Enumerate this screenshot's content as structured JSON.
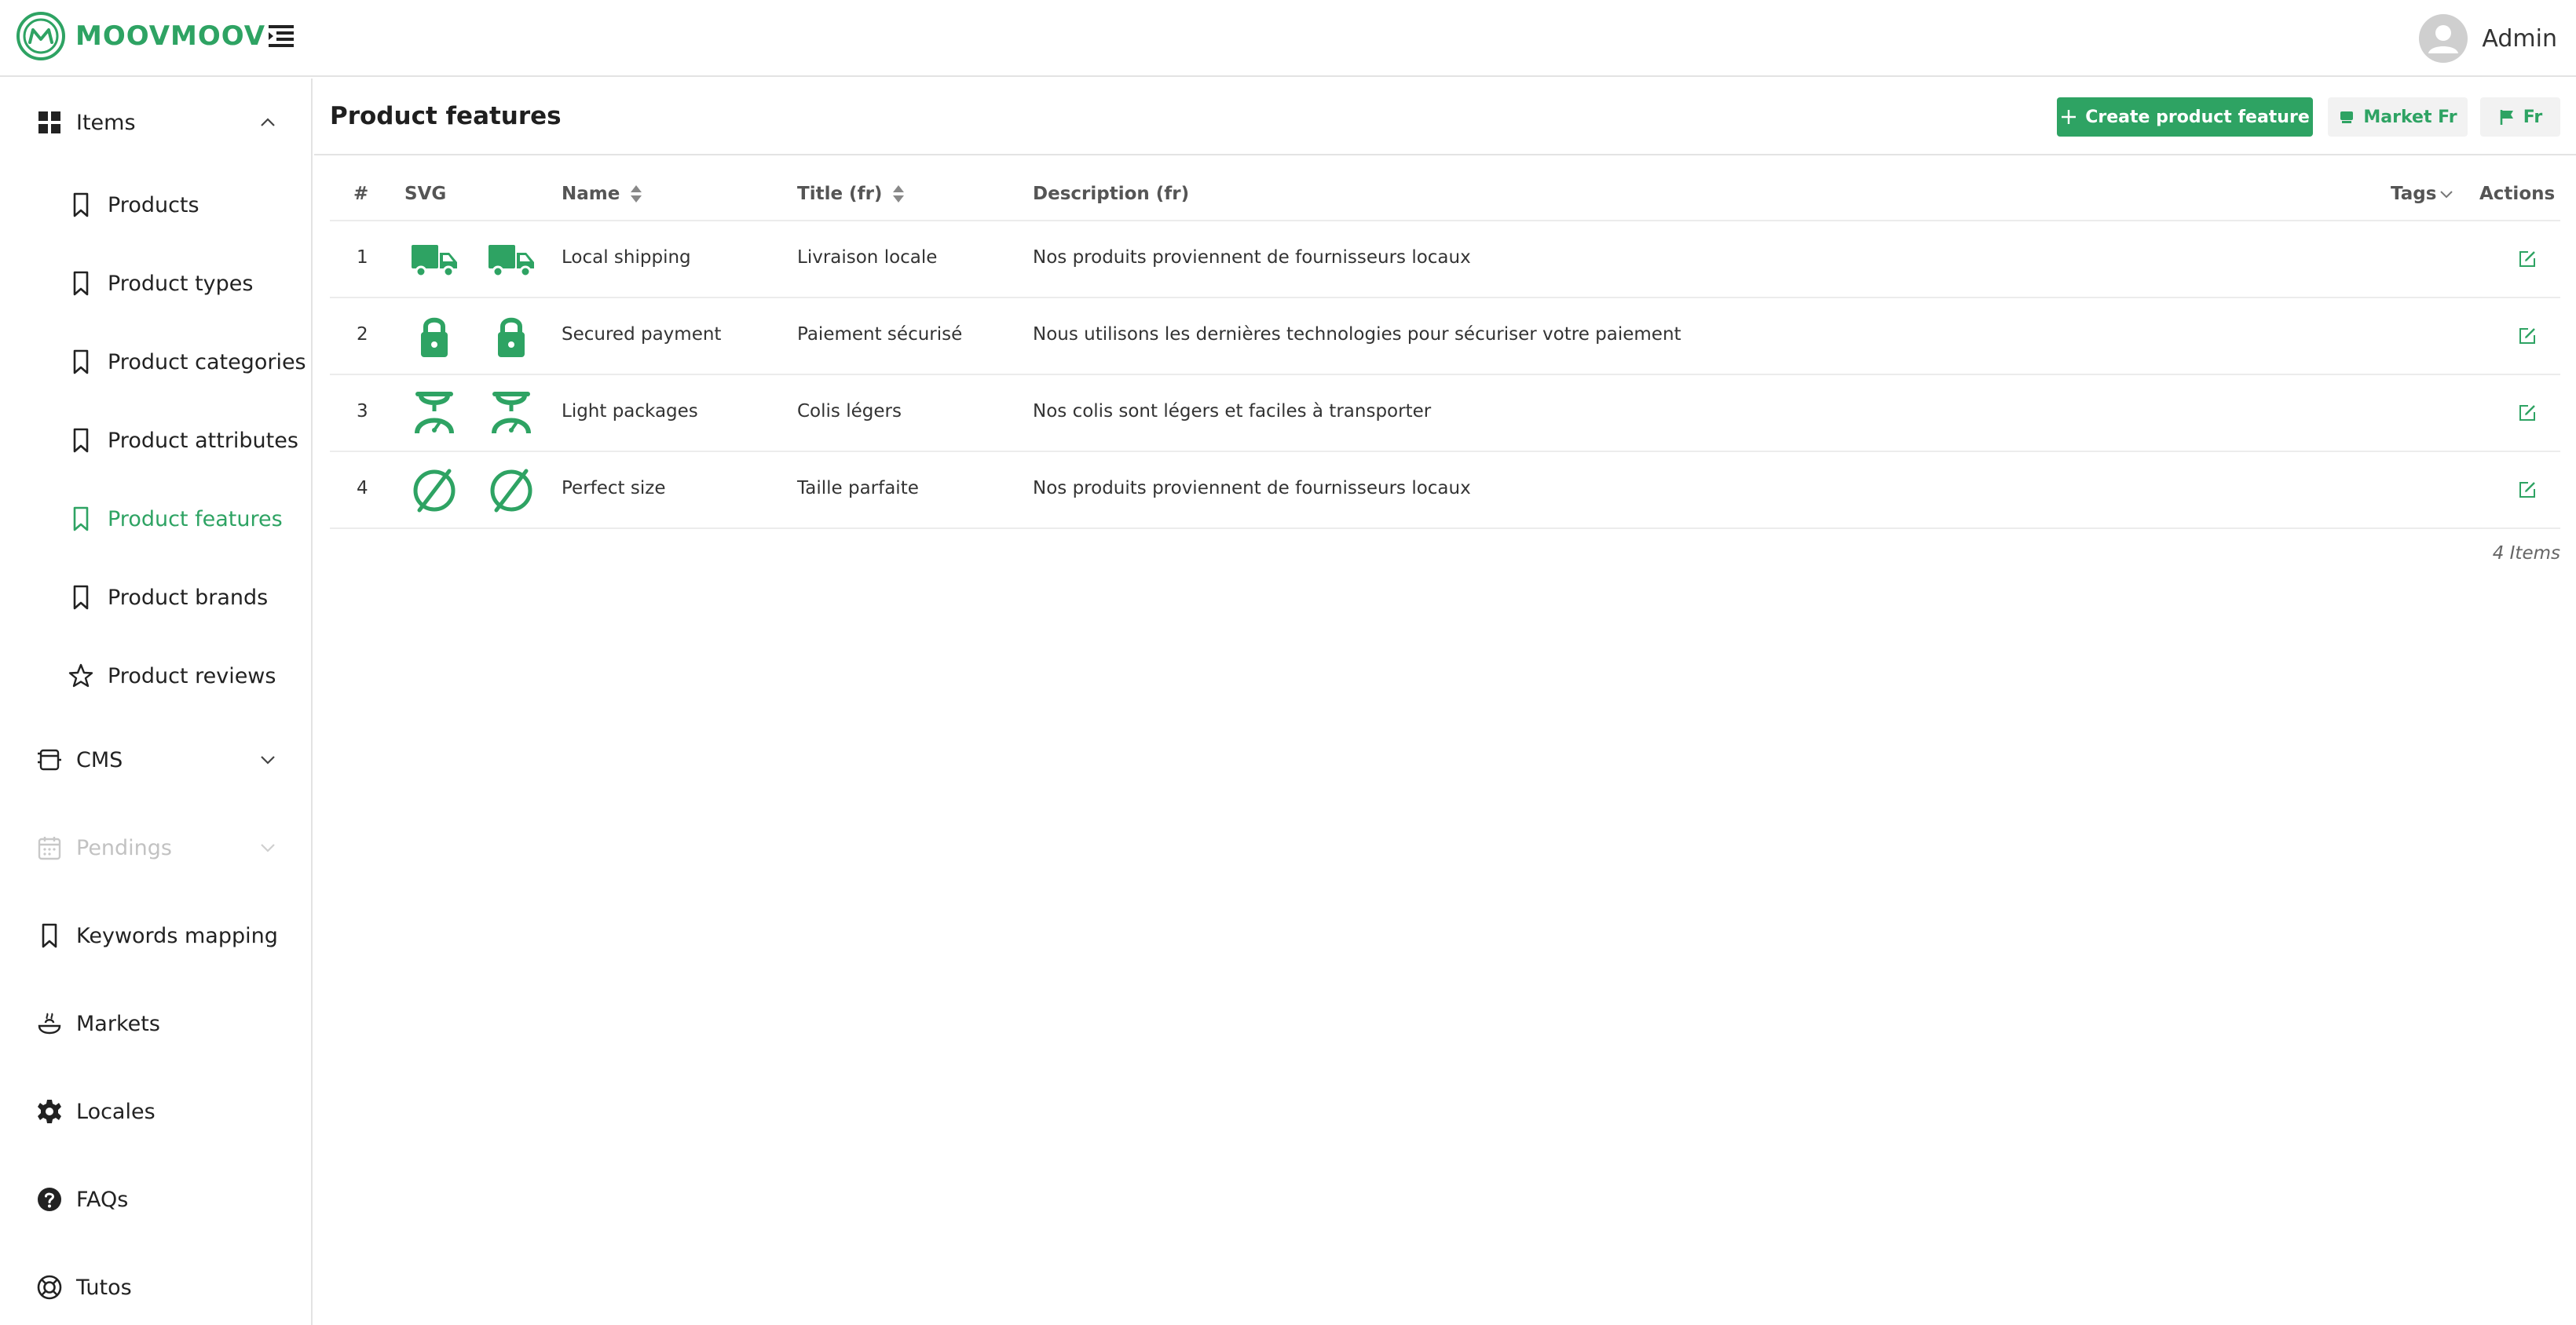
{
  "brand": {
    "name": "MOOVMOOV",
    "accent": "#2ea363"
  },
  "header": {
    "user_name": "Admin",
    "menu_icon": "menu-collapse-icon",
    "avatar_icon": "user-avatar-icon"
  },
  "sidebar": {
    "items": [
      {
        "label": "Items",
        "icon": "grid-icon",
        "expanded": true
      },
      {
        "label": "Products",
        "icon": "bookmark-icon"
      },
      {
        "label": "Product types",
        "icon": "bookmark-icon"
      },
      {
        "label": "Product categories",
        "icon": "bookmark-icon"
      },
      {
        "label": "Product attributes",
        "icon": "bookmark-icon"
      },
      {
        "label": "Product features",
        "icon": "bookmark-icon",
        "active": true
      },
      {
        "label": "Product brands",
        "icon": "bookmark-icon"
      },
      {
        "label": "Product reviews",
        "icon": "star-icon"
      },
      {
        "label": "CMS",
        "icon": "cms-icon",
        "expanded": false
      },
      {
        "label": "Pendings",
        "icon": "calendar-icon",
        "disabled": true
      },
      {
        "label": "Keywords mapping",
        "icon": "bookmark-icon"
      },
      {
        "label": "Markets",
        "icon": "market-icon"
      },
      {
        "label": "Locales",
        "icon": "gear-icon"
      },
      {
        "label": "FAQs",
        "icon": "question-icon"
      },
      {
        "label": "Tutos",
        "icon": "lifebuoy-icon"
      }
    ]
  },
  "main": {
    "title": "Product features",
    "buttons": {
      "create": "Create product feature",
      "market": "Market Fr",
      "locale": "Fr"
    },
    "table": {
      "columns": {
        "index": "#",
        "svg": "SVG",
        "name": "Name",
        "title": "Title (fr)",
        "description": "Description (fr)",
        "tags": "Tags",
        "actions": "Actions"
      },
      "rows": [
        {
          "index": "1",
          "icon": "truck-icon",
          "name": "Local shipping",
          "title": "Livraison locale",
          "description": "Nos produits proviennent de fournisseurs locaux"
        },
        {
          "index": "2",
          "icon": "lock-icon",
          "name": "Secured payment",
          "title": "Paiement sécurisé",
          "description": "Nous utilisons les dernières technologies pour sécuriser votre paiement"
        },
        {
          "index": "3",
          "icon": "scale-icon",
          "name": "Light packages",
          "title": "Colis légers",
          "description": "Nos colis sont légers et faciles à transporter"
        },
        {
          "index": "4",
          "icon": "empty-set-icon",
          "name": "Perfect size",
          "title": "Taille parfaite",
          "description": "Nos produits proviennent de fournisseurs locaux"
        }
      ],
      "count_label": "4 Items"
    }
  }
}
